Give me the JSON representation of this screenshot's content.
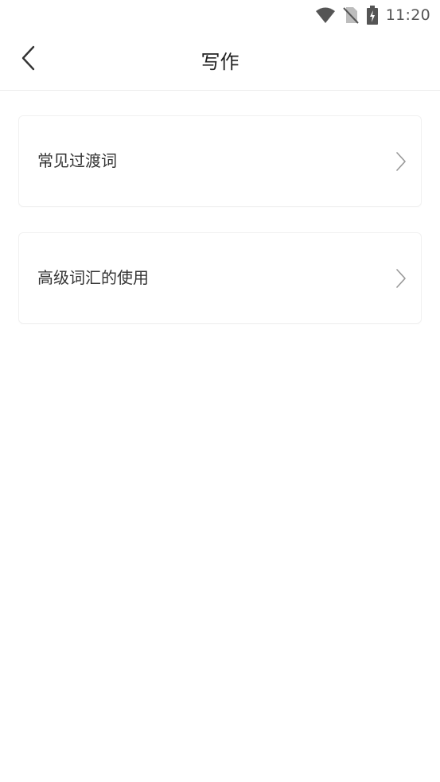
{
  "status_bar": {
    "time": "11:20",
    "icons": [
      "wifi-icon",
      "no-sim-icon",
      "battery-charging-icon"
    ]
  },
  "header": {
    "title": "写作",
    "back_icon": "chevron-left-icon"
  },
  "cards": [
    {
      "label": "常见过渡词",
      "icon": "chevron-right-icon"
    },
    {
      "label": "高级词汇的使用",
      "icon": "chevron-right-icon"
    }
  ],
  "colors": {
    "text_primary": "#222222",
    "card_text": "#333333",
    "icon_gray": "#555555",
    "chevron_gray": "#999999",
    "divider": "#ececec"
  }
}
